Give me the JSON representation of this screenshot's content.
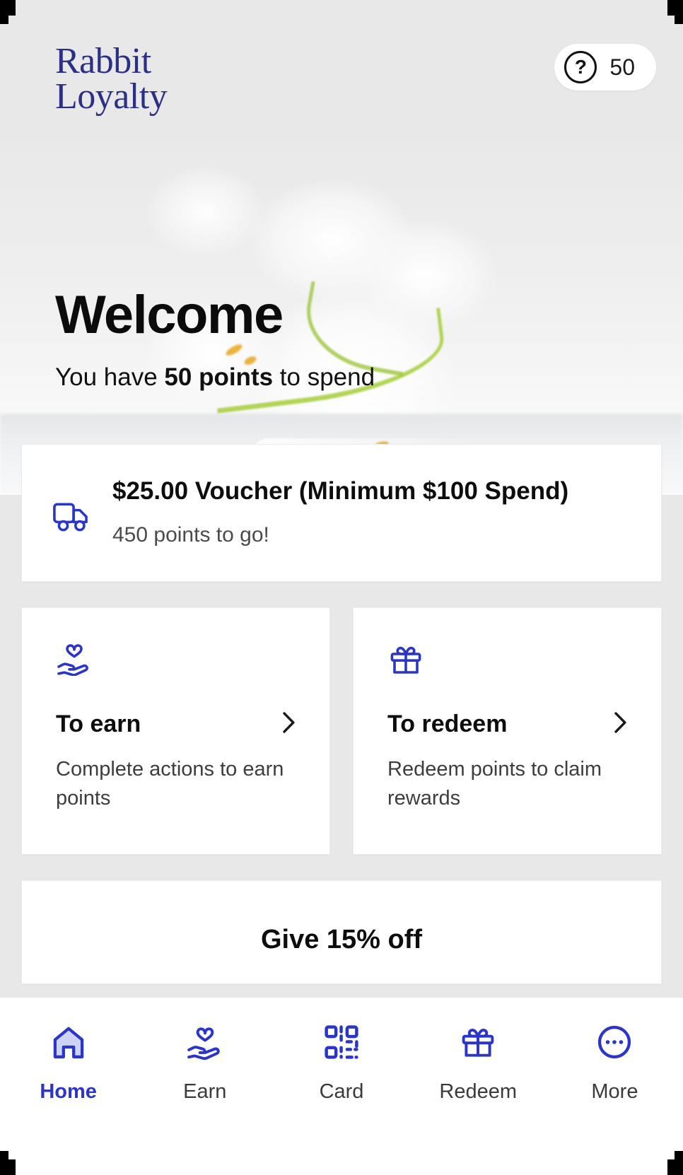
{
  "brand": {
    "name_line1": "Rabbit",
    "name_line2": "Loyalty",
    "accent_color": "#2b35c7",
    "logo_color": "#2b2f86"
  },
  "header": {
    "help_icon": "question-circle-icon",
    "points_value": "50"
  },
  "hero": {
    "title": "Welcome",
    "subtitle_prefix": "You have ",
    "subtitle_strong": "50 points",
    "subtitle_suffix": " to spend"
  },
  "voucher": {
    "icon": "delivery-truck-icon",
    "title": "$25.00 Voucher (Minimum $100 Spend)",
    "progress_text": "450 points to go!"
  },
  "tiles": [
    {
      "icon": "hand-heart-icon",
      "title": "To earn",
      "description": "Complete actions to earn points",
      "chevron": "chevron-right-icon"
    },
    {
      "icon": "gift-icon",
      "title": "To redeem",
      "description": "Redeem points to claim rewards",
      "chevron": "chevron-right-icon"
    }
  ],
  "promo": {
    "title": "Give 15% off"
  },
  "bottom_nav": {
    "items": [
      {
        "icon": "home-icon",
        "label": "Home",
        "active": true
      },
      {
        "icon": "hand-heart-icon",
        "label": "Earn",
        "active": false
      },
      {
        "icon": "qr-code-icon",
        "label": "Card",
        "active": false
      },
      {
        "icon": "gift-icon",
        "label": "Redeem",
        "active": false
      },
      {
        "icon": "more-dots-icon",
        "label": "More",
        "active": false
      }
    ]
  }
}
